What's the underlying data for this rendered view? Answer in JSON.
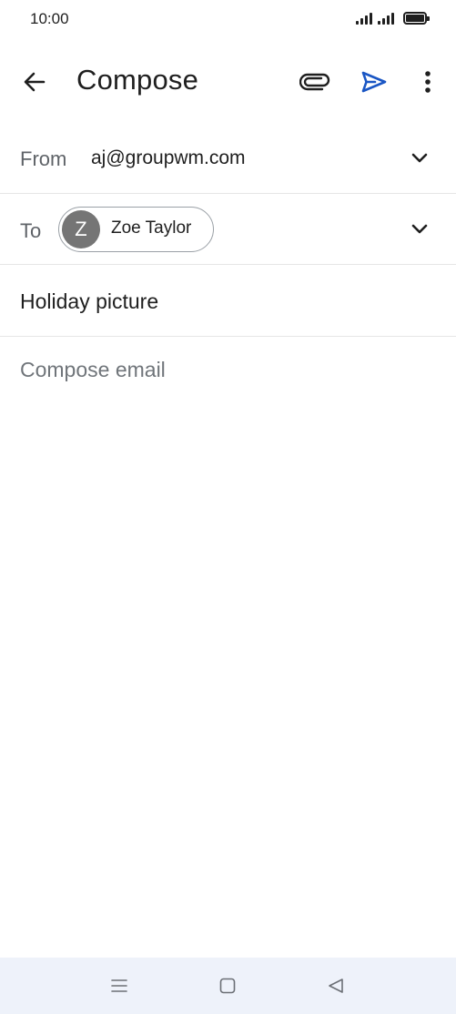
{
  "status_bar": {
    "time": "10:00",
    "icons": [
      "signal-1-icon",
      "signal-2-icon",
      "battery-icon"
    ]
  },
  "app_bar": {
    "title": "Compose",
    "icons": {
      "back": "arrow-back-icon",
      "attach": "paperclip-icon",
      "send": "send-icon",
      "more": "more-vert-icon"
    },
    "colors": {
      "send": "#1a56c4"
    }
  },
  "from": {
    "label": "From",
    "value": "aj@groupwm.com"
  },
  "to": {
    "label": "To",
    "recipients": [
      {
        "initial": "Z",
        "name": "Zoe Taylor",
        "avatar_color": "#757575"
      }
    ]
  },
  "subject": {
    "value": "Holiday picture"
  },
  "body": {
    "placeholder": "Compose email"
  },
  "nav_bar": {
    "icons": [
      "menu-icon",
      "home-icon",
      "back-triangle-icon"
    ],
    "background": "#eef2fa"
  }
}
